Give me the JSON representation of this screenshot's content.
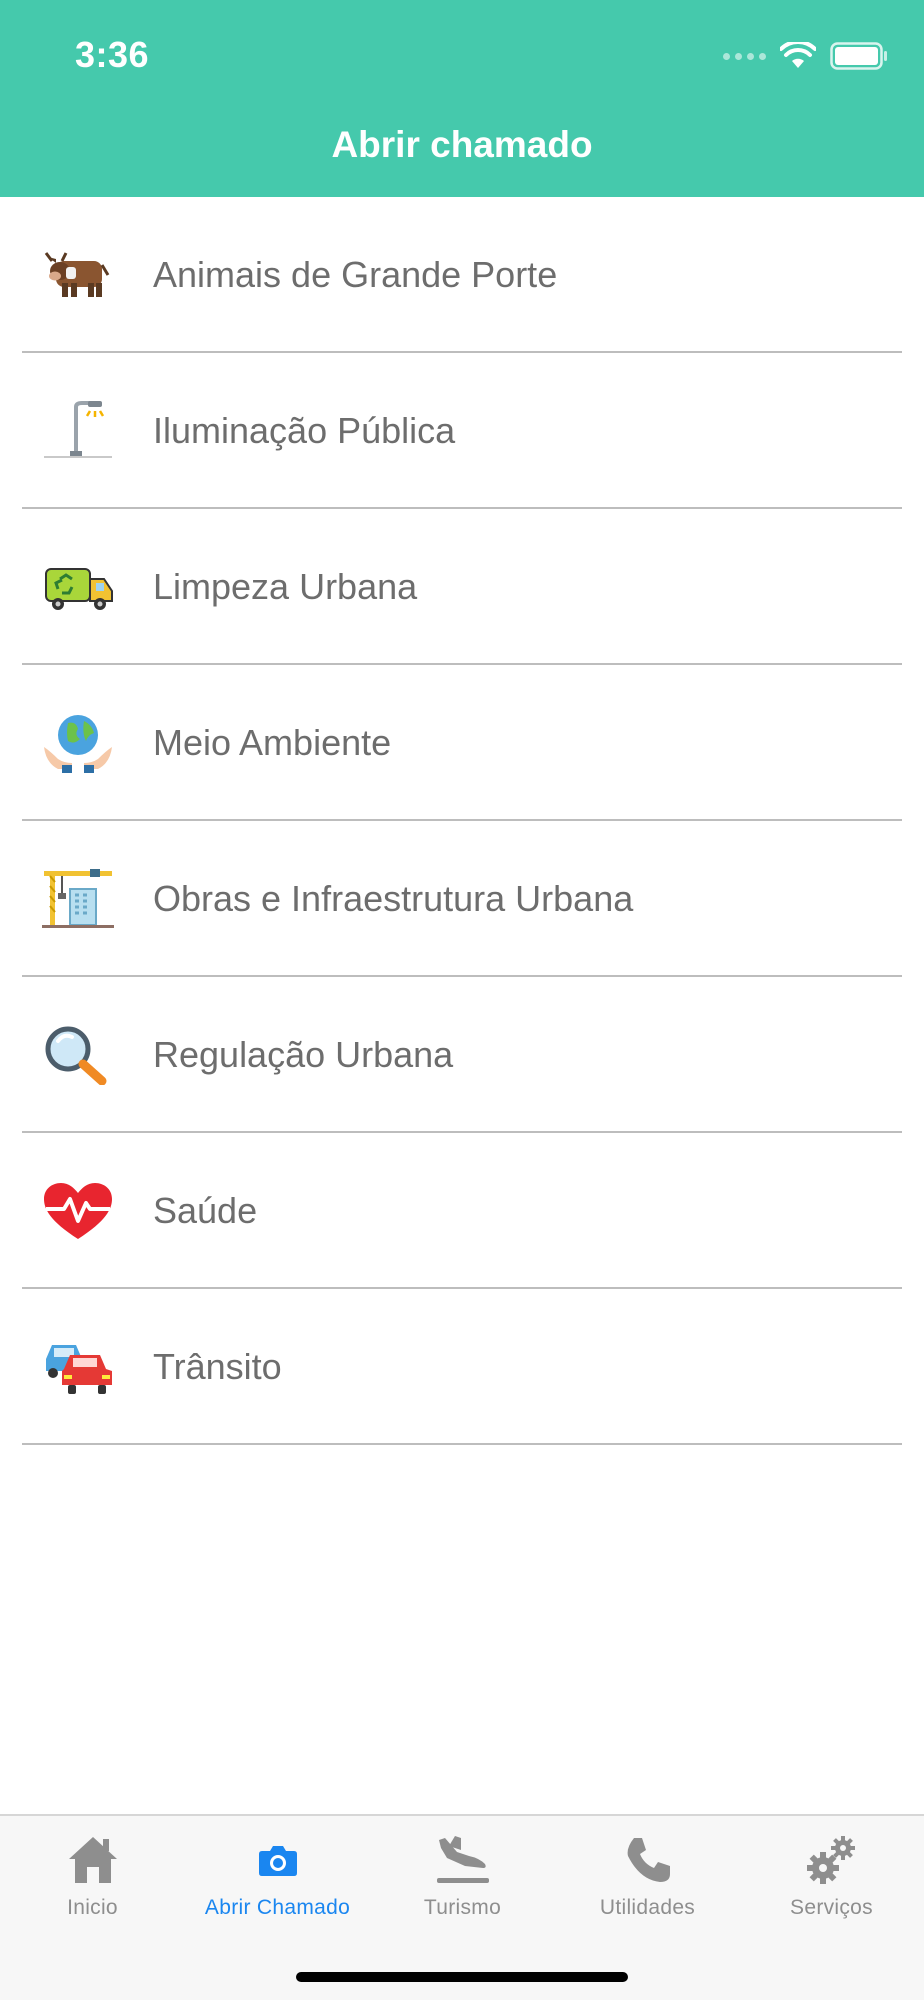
{
  "status_bar": {
    "time": "3:36",
    "icons": [
      "signal-dots-icon",
      "wifi-icon",
      "battery-icon"
    ]
  },
  "header": {
    "title": "Abrir chamado",
    "background": "#45c9ac"
  },
  "categories": [
    {
      "label": "Animais de Grande Porte",
      "icon": "cow-icon"
    },
    {
      "label": "Iluminação Pública",
      "icon": "street-lamp-icon"
    },
    {
      "label": "Limpeza Urbana",
      "icon": "garbage-truck-icon"
    },
    {
      "label": "Meio Ambiente",
      "icon": "globe-hands-icon"
    },
    {
      "label": "Obras e Infraestrutura Urbana",
      "icon": "construction-crane-icon"
    },
    {
      "label": "Regulação Urbana",
      "icon": "magnifier-icon"
    },
    {
      "label": "Saúde",
      "icon": "heart-pulse-icon"
    },
    {
      "label": "Trânsito",
      "icon": "cars-icon"
    }
  ],
  "tabbar": {
    "active_color": "#1a86f0",
    "tabs": [
      {
        "label": "Inicio",
        "icon": "home-icon",
        "active": false
      },
      {
        "label": "Abrir Chamado",
        "icon": "camera-icon",
        "active": true
      },
      {
        "label": "Turismo",
        "icon": "plane-landing-icon",
        "active": false
      },
      {
        "label": "Utilidades",
        "icon": "phone-icon",
        "active": false
      },
      {
        "label": "Serviços",
        "icon": "gears-icon",
        "active": false
      }
    ]
  }
}
